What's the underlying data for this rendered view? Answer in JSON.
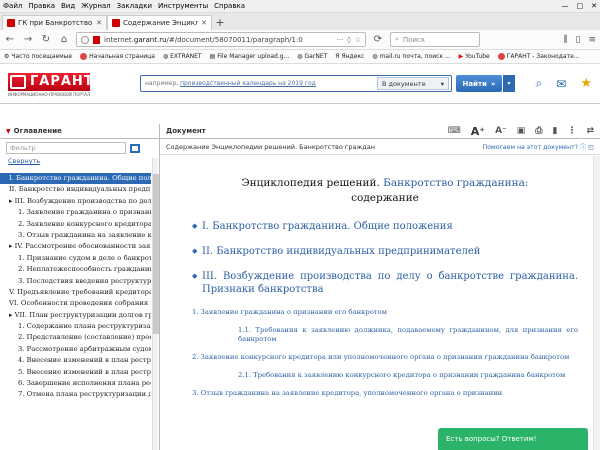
{
  "browser": {
    "menu": [
      "Файл",
      "Правка",
      "Вид",
      "Журнал",
      "Закладки",
      "Инструменты",
      "Справка"
    ],
    "tabs": [
      {
        "title": "ГК при Банкротство гражд.."
      },
      {
        "title": "Содержание Энциклопедии реш"
      }
    ],
    "url_prefix": "internet.",
    "url_host": "garant.ru",
    "url_rest": "/#/document/58070011/paragraph/1:0",
    "search_placeholder": "Поиск",
    "bookmarks": [
      "Часто посещаемые",
      "Начальная страница",
      "EXTRANET",
      "File Manager upload.g...",
      "GarNET",
      "Яндекс",
      "mail.ru почта, поиск ...",
      "YouTube",
      "ГАРАНТ - Законодате..."
    ]
  },
  "garant": {
    "logo_text": "ГАРАНТ",
    "logo_sub": "ИНФОРМАЦИОННО-ПРАВОВОЙ ПОРТАЛ",
    "search_placeholder_prefix": "например, ",
    "search_placeholder_link": "производственный календарь на 2019 год",
    "search_scope": "В документе",
    "search_button": "Найти"
  },
  "left_panel": {
    "tab_label": "Оглавление",
    "filter_placeholder": "Фильтр",
    "collapse_link": "Свернуть",
    "toc": [
      {
        "text": "I. Банкротство гражданина. Общие поло",
        "level": 0,
        "selected": true
      },
      {
        "text": "II. Банкротство индивидуальных предпр",
        "level": 0
      },
      {
        "text": "▸ III. Возбуждение производства по делу о",
        "level": 0
      },
      {
        "text": "1. Заявление гражданина о признани",
        "level": 1
      },
      {
        "text": "2. Заявление конкурсного кредитора и",
        "level": 1
      },
      {
        "text": "3. Отзыв гражданина на заявление кр",
        "level": 1
      },
      {
        "text": "▸ IV. Рассмотрение обоснованности заявле",
        "level": 0
      },
      {
        "text": "1. Признание судом в деле о банкротст",
        "level": 1
      },
      {
        "text": "2. Неплатежеспособность гражданина",
        "level": 1
      },
      {
        "text": "3. Последствия введения реструктури",
        "level": 1
      },
      {
        "text": "V. Предъявление требований кредиторам",
        "level": 0
      },
      {
        "text": "VI. Особенности проведения собрания кр",
        "level": 0
      },
      {
        "text": "▸ VII. План реструктуризации долгов гражда",
        "level": 0
      },
      {
        "text": "1. Содержание плана реструктуризаци",
        "level": 1
      },
      {
        "text": "2. Представление (составление) проект",
        "level": 1
      },
      {
        "text": "3. Рассмотрение арбитражным судом п",
        "level": 1
      },
      {
        "text": "4. Внесение изменений в план реструк",
        "level": 1
      },
      {
        "text": "5. Внесение изменений в план реструк",
        "level": 1
      },
      {
        "text": "6. Завершение исполнения плана рест",
        "level": 1
      },
      {
        "text": "7. Отмена плана реструктуризации дол",
        "level": 1
      }
    ]
  },
  "doc_panel": {
    "tab_label": "Документ",
    "breadcrumb": "Содержание Энциклопедии решений. Банкротство граждан",
    "help_link": "Помогаем на этот документ?",
    "title_black1": "Энциклопедия решений.",
    "title_blue": "Банкротство гражданина:",
    "title_black2": "содержание",
    "sections": [
      {
        "type": "sec",
        "text": "I. Банкротство гражданина. Общие положения"
      },
      {
        "type": "sec",
        "text": "II. Банкротство индивидуальных предпринимателей"
      },
      {
        "type": "sec",
        "text": "III. Возбуждение производства по делу о банкротстве гражданина. Признаки банкротства"
      },
      {
        "type": "item",
        "text": "1. Заявление гражданина о признании его банкротом"
      },
      {
        "type": "item-ind",
        "text": "1.1. Требования к заявлению должника, подаваемому гражданином, для признания его банкротом"
      },
      {
        "type": "item",
        "text": "2. Заявление конкурсного кредитора или уполномоченного органа о признании гражданина банкротом"
      },
      {
        "type": "item-ind",
        "text": "2.1. Требования к заявлению конкурсного кредитора о признании гражданина банкротом"
      },
      {
        "type": "item",
        "text": "3. Отзыв гражданина на заявление кредитора, уполномоченного органа о признании"
      }
    ],
    "chat_label": "Есть вопросы? Ответим!"
  },
  "colors": {
    "brand_red": "#cc1122",
    "link_blue": "#2b5fa5",
    "selection": "#2b69b4",
    "chat_green": "#2bb36a"
  }
}
